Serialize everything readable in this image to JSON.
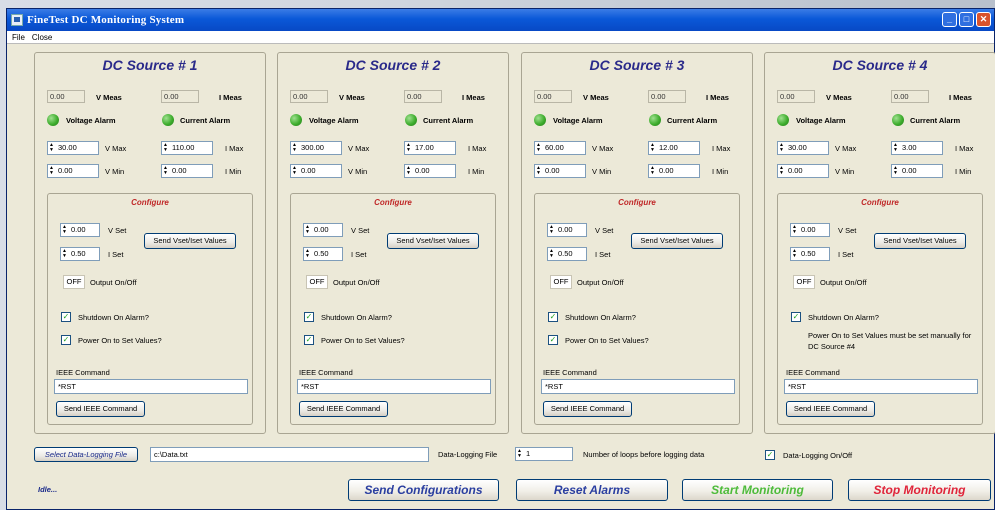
{
  "window": {
    "title": "FineTest DC Monitoring System"
  },
  "menu": [
    "File",
    "Close"
  ],
  "sources": [
    {
      "title": "DC Source # 1",
      "v_meas": "0.00",
      "i_meas": "0.00",
      "v_max": "30.00",
      "i_max": "110.00",
      "v_min": "0.00",
      "i_min": "0.00",
      "v_set": "0.00",
      "i_set": "0.50",
      "shutdown": "Shutdown On Alarm?",
      "power_on": "Power On to Set Values?",
      "note": "",
      "ieee": "*RST"
    },
    {
      "title": "DC Source # 2",
      "v_meas": "0.00",
      "i_meas": "0.00",
      "v_max": "300.00",
      "i_max": "17.00",
      "v_min": "0.00",
      "i_min": "0.00",
      "v_set": "0.00",
      "i_set": "0.50",
      "shutdown": "Shutdown On Alarm?",
      "power_on": "Power On to Set Values?",
      "note": "",
      "ieee": "*RST"
    },
    {
      "title": "DC Source # 3",
      "v_meas": "0.00",
      "i_meas": "0.00",
      "v_max": "60.00",
      "i_max": "12.00",
      "v_min": "0.00",
      "i_min": "0.00",
      "v_set": "0.00",
      "i_set": "0.50",
      "shutdown": "Shutdown On Alarm?",
      "power_on": "Power On to Set Values?",
      "note": "",
      "ieee": "*RST"
    },
    {
      "title": "DC Source # 4",
      "v_meas": "0.00",
      "i_meas": "0.00",
      "v_max": "30.00",
      "i_max": "3.00",
      "v_min": "0.00",
      "i_min": "0.00",
      "v_set": "0.00",
      "i_set": "0.50",
      "shutdown": "Shutdown On Alarm?",
      "power_on": "",
      "note": "Power On to Set Values must be set manually for DC Source #4",
      "ieee": "*RST"
    }
  ],
  "labels": {
    "v_meas": "V Meas",
    "i_meas": "I Meas",
    "voltage_alarm": "Voltage Alarm",
    "current_alarm": "Current Alarm",
    "v_max": "V Max",
    "i_max": "I Max",
    "v_min": "V Min",
    "i_min": "I Min",
    "configure": "Configure",
    "v_set": "V Set",
    "i_set": "I Set",
    "send_vset": "Send Vset/Iset Values",
    "off": "OFF",
    "output": "Output On/Off",
    "ieee_label": "IEEE Command",
    "send_ieee": "Send IEEE Command"
  },
  "bottom": {
    "select_file": "Select Data-Logging File",
    "file_path": "c:\\Data.txt",
    "file_label": "Data-Logging File",
    "loops": "1",
    "loops_label": "Number of loops before logging data",
    "logging_label": "Data-Logging On/Off",
    "status": "Idle...",
    "send_config": "Send Configurations",
    "reset_alarms": "Reset Alarms",
    "start": "Start Monitoring",
    "stop": "Stop Monitoring"
  },
  "colors": {
    "title_blue": "#2a2a8a",
    "configure_red": "#c02828",
    "start_green": "#4dbb3a",
    "stop_red": "#e0243a",
    "led_green": "#3fae2e"
  }
}
